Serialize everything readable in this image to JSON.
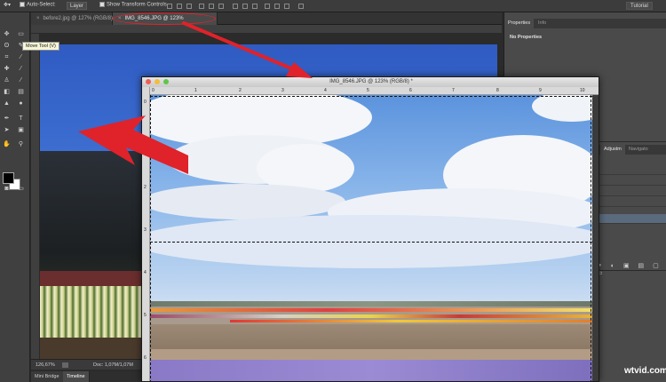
{
  "options_bar": {
    "auto_select_label": "Auto-Select:",
    "auto_select_target": "Layer",
    "show_transform_label": "Show Transform Controls",
    "workspace": "Tutorial"
  },
  "tools": {
    "tooltip": "Move Tool (V)"
  },
  "document_tabs": [
    {
      "label": "before2.jpg @ 127% (RGB/8)"
    },
    {
      "label": "IMG_8546.JPG @ 123%"
    }
  ],
  "status_bar": {
    "zoom": "126,67%",
    "doc_info": "Doc: 1,07M/1,07M"
  },
  "bottom_tabs": [
    {
      "label": "Mini Bridge"
    },
    {
      "label": "Timeline"
    }
  ],
  "right_panel": {
    "tabs": [
      "Properties",
      "Info"
    ],
    "no_properties": "No Properties",
    "lower_tabs": [
      "Adjustm",
      "Navigato"
    ]
  },
  "floating_window": {
    "title": "IMG_8546.JPG @ 123% (RGB/8) *",
    "ruler_top": [
      "0",
      "1",
      "2",
      "3",
      "4",
      "5",
      "6",
      "7",
      "8",
      "9",
      "10"
    ],
    "ruler_left": [
      "0",
      "1",
      "2",
      "3",
      "4",
      "5",
      "6"
    ]
  },
  "colors": {
    "accent_red": "#e0222a",
    "panel_bg": "#4a4a4a",
    "selected_layer": "#5b6b7e"
  },
  "watermark": "wtvid.com"
}
